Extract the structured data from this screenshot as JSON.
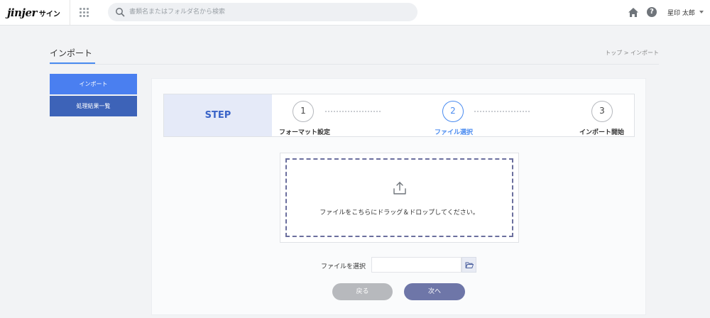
{
  "header": {
    "logo_word": "jinjer",
    "logo_sub": "サイン",
    "search_placeholder": "書類名またはフォルダ名から検索",
    "user_name": "星印 太郎",
    "help_symbol": "?"
  },
  "page": {
    "title": "インポート",
    "breadcrumb": "トップ > インポート"
  },
  "sidebar": {
    "items": [
      {
        "label": "インポート",
        "active": true
      },
      {
        "label": "処理結果一覧",
        "active": false
      }
    ]
  },
  "stepper": {
    "label": "STEP",
    "current_step": 2,
    "steps": [
      {
        "number": "1",
        "name": "フォーマット設定"
      },
      {
        "number": "2",
        "name": "ファイル選択"
      },
      {
        "number": "3",
        "name": "インポート開始"
      }
    ]
  },
  "upload": {
    "icon": "upload-icon",
    "drop_text": "ファイルをこちらにドラッグ＆ドロップしてください。",
    "file_label": "ファイルを選択",
    "file_value": "",
    "folder_icon": "folder-open-icon"
  },
  "actions": {
    "back_label": "戻る",
    "next_label": "次へ"
  },
  "colors": {
    "accent": "#4a8bf0",
    "sidebar_active": "#4a7ff0",
    "sidebar_normal": "#3d63b8",
    "next_button": "#6e76a8",
    "back_button": "#b7b9bd"
  }
}
